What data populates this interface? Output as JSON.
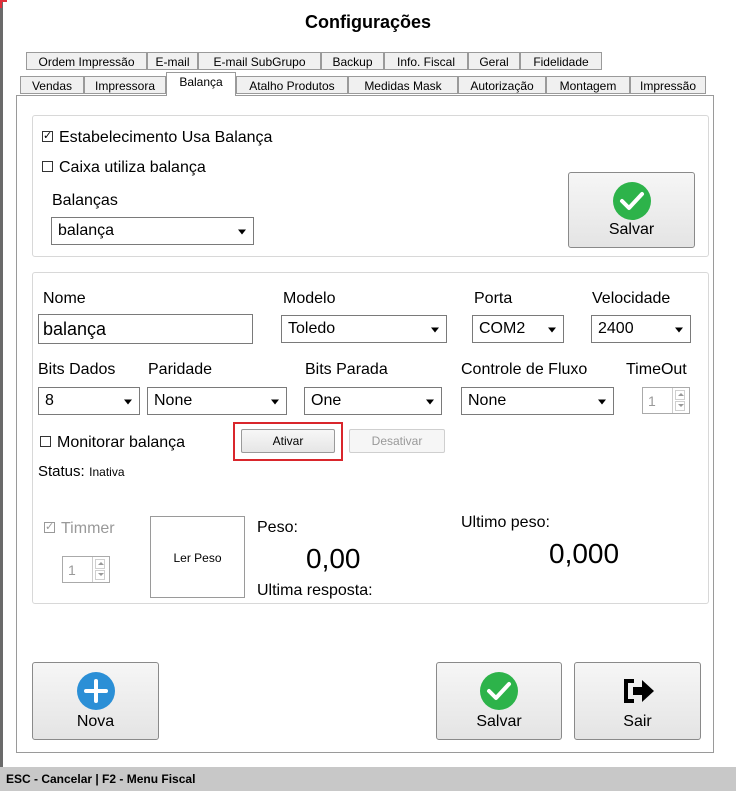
{
  "window": {
    "title": "Configurações"
  },
  "tabs_row1": [
    "Ordem Impressão",
    "E-mail",
    "E-mail SubGrupo",
    "Backup",
    "Info. Fiscal",
    "Geral",
    "Fidelidade"
  ],
  "tabs_row2": [
    "Vendas",
    "Impressora",
    "Balança",
    "Atalho Produtos",
    "Medidas Mask",
    "Autorização",
    "Montagem",
    "Impressão"
  ],
  "active_tab": "Balança",
  "establishment": {
    "uses_scale_label": "Estabelecimento Usa Balança",
    "uses_scale_checked": true,
    "cashier_uses_scale_label": "Caixa utiliza balança",
    "cashier_uses_scale_checked": false,
    "scales_label": "Balanças",
    "scales_selected": "balança",
    "save_label": "Salvar"
  },
  "scale": {
    "name_label": "Nome",
    "name_value": "balança",
    "model_label": "Modelo",
    "model_value": "Toledo",
    "port_label": "Porta",
    "port_value": "COM2",
    "speed_label": "Velocidade",
    "speed_value": "2400",
    "data_bits_label": "Bits Dados",
    "data_bits_value": "8",
    "parity_label": "Paridade",
    "parity_value": "None",
    "stop_bits_label": "Bits Parada",
    "stop_bits_value": "One",
    "flow_control_label": "Controle de Fluxo",
    "flow_control_value": "None",
    "timeout_label": "TimeOut",
    "timeout_value": "1",
    "monitor_label": "Monitorar balança",
    "monitor_checked": false,
    "activate_label": "Ativar",
    "deactivate_label": "Desativar",
    "status_label": "Status:",
    "status_value": "Inativa",
    "timer_label": "Timmer",
    "timer_checked": true,
    "timer_value": "1",
    "read_weight_label": "Ler Peso",
    "weight_label": "Peso:",
    "weight_value": "0,00",
    "last_response_label": "Ultima resposta:",
    "last_weight_label": "Ultimo peso:",
    "last_weight_value": "0,000"
  },
  "footer_buttons": {
    "new_label": "Nova",
    "save_label": "Salvar",
    "exit_label": "Sair"
  },
  "statusbar": {
    "text": "ESC - Cancelar  |  F2 - Menu Fiscal"
  },
  "colors": {
    "success_green": "#2db34a",
    "info_blue": "#2b8fd6",
    "highlight_red": "#d9262c"
  }
}
